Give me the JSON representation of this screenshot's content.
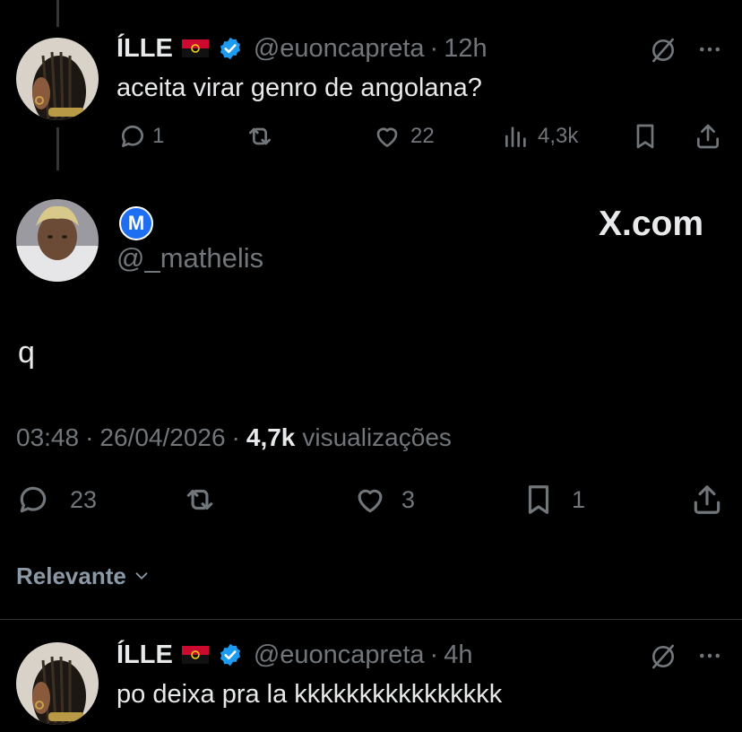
{
  "tweet1": {
    "name": "ÍLLE",
    "handle": "@euoncapreta",
    "separator": "·",
    "time": "12h",
    "text": "aceita virar genro de angolana?",
    "replies": "1",
    "likes": "22",
    "views": "4,3k"
  },
  "main_tweet": {
    "badge": "M",
    "handle": "@_mathelis",
    "watermark": "X.com",
    "text": "q",
    "time": "03:48",
    "sep1": "·",
    "date": "26/04/2026",
    "sep2": "·",
    "views_count": "4,7k",
    "views_label": "visualizações",
    "replies": "23",
    "likes": "3",
    "bookmarks": "1"
  },
  "sort": {
    "label": "Relevante"
  },
  "tweet2": {
    "name": "ÍLLE",
    "handle": "@euoncapreta",
    "separator": "·",
    "time": "4h",
    "text": "po deixa pra la kkkkkkkkkkkkkkkk"
  },
  "colors": {
    "background": "#000000",
    "text": "#e7e9ea",
    "muted": "#71767b",
    "verified": "#1d9bf0",
    "divider": "#2f3336"
  },
  "icons": [
    "reply-icon",
    "retweet-icon",
    "like-icon",
    "views-icon",
    "bookmark-icon",
    "share-icon",
    "grok-icon",
    "more-icon",
    "verified-icon",
    "angola-flag-icon",
    "chevron-down-icon"
  ]
}
